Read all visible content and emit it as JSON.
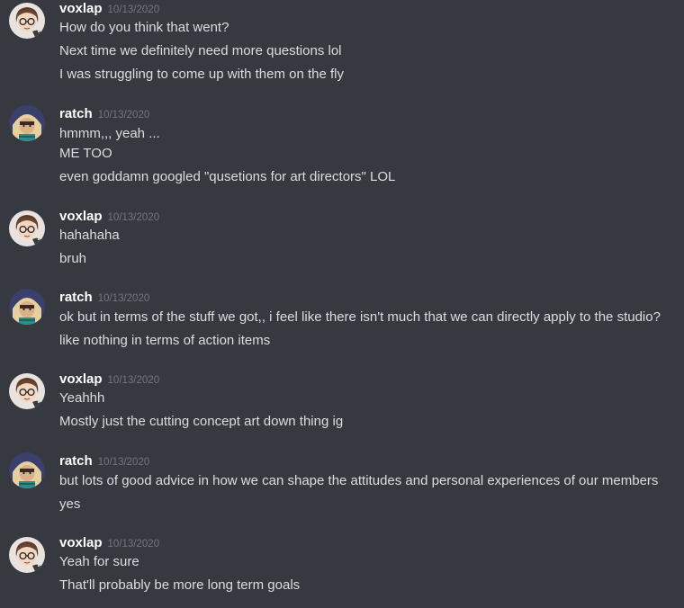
{
  "colors": {
    "background": "#36393f",
    "username": "#ffffff",
    "timestamp": "#72767d",
    "message_text": "#dcddde"
  },
  "messages": [
    {
      "author": "voxlap",
      "timestamp": "10/13/2020",
      "avatar_icon": "voxlap-avatar-icon",
      "lines": [
        "How do you think that went?",
        "Next time we definitely need more questions lol",
        "I was struggling to come up with them on the fly"
      ]
    },
    {
      "author": "ratch",
      "timestamp": "10/13/2020",
      "avatar_icon": "ratch-avatar-icon",
      "lines": [
        "hmmm,,, yeah ...",
        "ME TOO",
        "even goddamn googled \"qusetions for art directors\" LOL"
      ]
    },
    {
      "author": "voxlap",
      "timestamp": "10/13/2020",
      "avatar_icon": "voxlap-avatar-icon",
      "lines": [
        "hahahaha",
        "bruh"
      ]
    },
    {
      "author": "ratch",
      "timestamp": "10/13/2020",
      "avatar_icon": "ratch-avatar-icon",
      "lines": [
        "ok but in terms of the stuff we got,, i feel like there isn't much that we can directly apply to the studio?",
        "like nothing in terms of action items"
      ]
    },
    {
      "author": "voxlap",
      "timestamp": "10/13/2020",
      "avatar_icon": "voxlap-avatar-icon",
      "lines": [
        "Yeahhh",
        "Mostly just the cutting concept art down thing ig"
      ]
    },
    {
      "author": "ratch",
      "timestamp": "10/13/2020",
      "avatar_icon": "ratch-avatar-icon",
      "lines": [
        "but lots of good advice in how we can shape the attitudes and personal experiences of our members",
        "yes"
      ]
    },
    {
      "author": "voxlap",
      "timestamp": "10/13/2020",
      "avatar_icon": "voxlap-avatar-icon",
      "lines": [
        "Yeah for sure",
        "That'll probably be more long term goals"
      ]
    }
  ]
}
